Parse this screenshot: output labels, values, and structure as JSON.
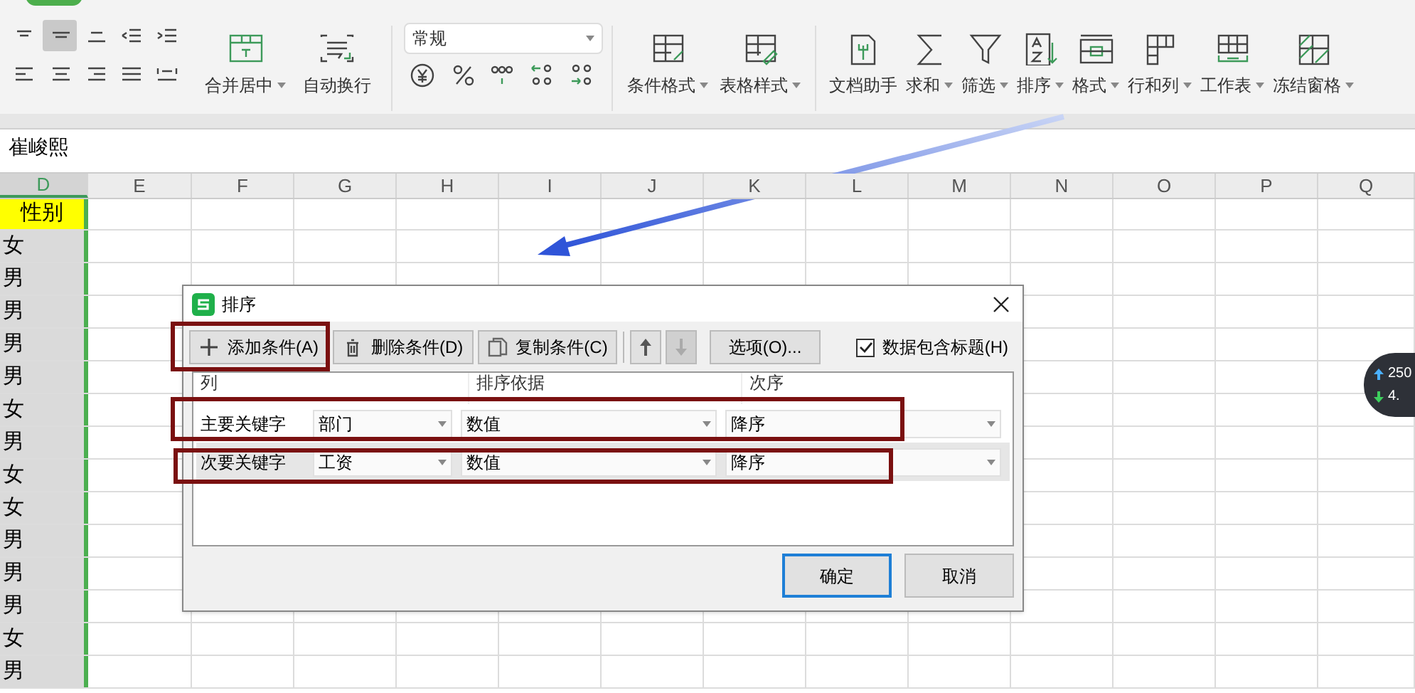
{
  "ribbon": {
    "align_buttons": [
      {
        "selected": false
      },
      {
        "selected": true
      },
      {
        "selected": false
      },
      {
        "selected": false
      },
      {
        "selected": false
      },
      {
        "selected": false
      },
      {
        "selected": false
      },
      {
        "selected": false
      },
      {
        "selected": false
      },
      {
        "selected": false
      }
    ],
    "cell_buttons": [
      {
        "label": "合并居中",
        "dropdown": true
      },
      {
        "label": "自动换行",
        "dropdown": false
      }
    ],
    "number_format": {
      "value": "常规"
    },
    "tools": [
      {
        "label": "条件格式",
        "dropdown": true
      },
      {
        "label": "表格样式",
        "dropdown": true
      },
      {
        "label": "文档助手",
        "dropdown": false
      },
      {
        "label": "求和",
        "dropdown": true
      },
      {
        "label": "筛选",
        "dropdown": true
      },
      {
        "label": "排序",
        "dropdown": true
      },
      {
        "label": "格式",
        "dropdown": true
      },
      {
        "label": "行和列",
        "dropdown": true
      },
      {
        "label": "工作表",
        "dropdown": true
      },
      {
        "label": "冻结窗格",
        "dropdown": true
      }
    ]
  },
  "formula_bar": {
    "value": "崔峻熙"
  },
  "sheet": {
    "columns": [
      {
        "label": "D",
        "selected": true
      },
      {
        "label": "E",
        "selected": false
      },
      {
        "label": "F",
        "selected": false
      },
      {
        "label": "G",
        "selected": false
      },
      {
        "label": "H",
        "selected": false
      },
      {
        "label": "I",
        "selected": false
      },
      {
        "label": "J",
        "selected": false
      },
      {
        "label": "K",
        "selected": false
      },
      {
        "label": "L",
        "selected": false
      },
      {
        "label": "M",
        "selected": false
      },
      {
        "label": "N",
        "selected": false
      },
      {
        "label": "O",
        "selected": false
      },
      {
        "label": "P",
        "selected": false
      },
      {
        "label": "Q",
        "selected": false
      }
    ],
    "header_cell": "性别",
    "cells": [
      "女",
      "男",
      "男",
      "男",
      "男",
      "女",
      "男",
      "女",
      "女",
      "男",
      "男",
      "男",
      "女",
      "男"
    ]
  },
  "dialog": {
    "title": "排序",
    "toolbar": [
      {
        "label": "添加条件(A)",
        "kind": "add"
      },
      {
        "label": "删除条件(D)",
        "kind": "delete"
      },
      {
        "label": "复制条件(C)",
        "kind": "copy"
      }
    ],
    "move_buttons": [
      {
        "kind": "up",
        "disabled": false
      },
      {
        "kind": "down",
        "disabled": true
      }
    ],
    "options_button": "选项(O)...",
    "header_checkbox": {
      "label": "数据包含标题(H)",
      "checked": true
    },
    "columns": [
      "列",
      "排序依据",
      "次序"
    ],
    "rows": [
      {
        "label": "主要关键字",
        "key": "部门",
        "basis": "数值",
        "order": "降序",
        "selected": false
      },
      {
        "label": "次要关键字",
        "key": "工资",
        "basis": "数值",
        "order": "降序",
        "selected": true
      }
    ],
    "buttons": [
      {
        "label": "确定",
        "default": true
      },
      {
        "label": "取消",
        "default": false
      }
    ]
  },
  "ticker": [
    {
      "kind": "up",
      "value": "250"
    },
    {
      "kind": "down",
      "value": "4."
    }
  ]
}
